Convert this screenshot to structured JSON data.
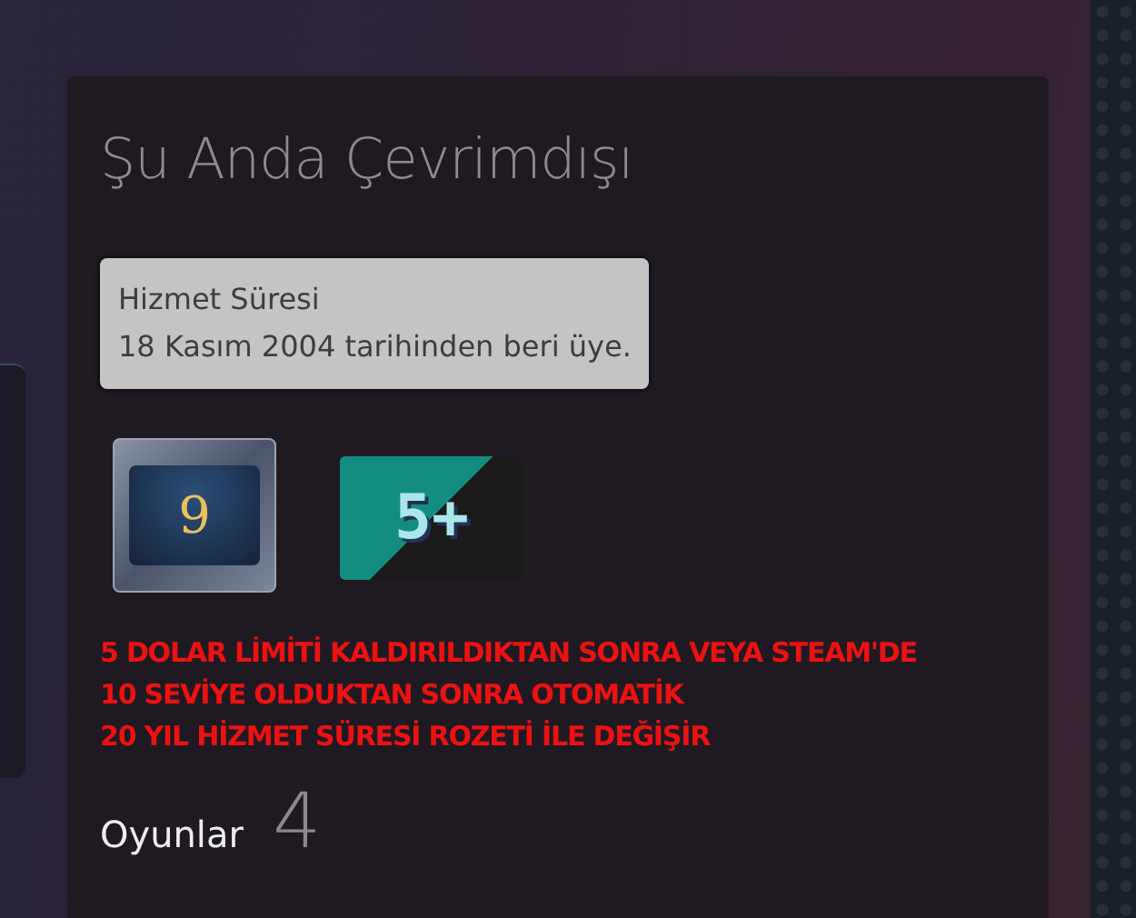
{
  "status": {
    "title": "Şu Anda Çevrimdışı"
  },
  "tooltip": {
    "heading": "Hizmet Süresi",
    "text": "18 Kasım 2004 tarihinden beri üye."
  },
  "badges": [
    {
      "kind": "years",
      "label": "9"
    },
    {
      "kind": "level",
      "label": "5+"
    }
  ],
  "note": [
    "5 DOLAR LİMİTİ KALDIRILDIKTAN SONRA VEYA STEAM'DE",
    "10 SEVİYE OLDUKTAN SONRA OTOMATİK",
    "20 YIL HİZMET SÜRESİ ROZETİ İLE DEĞİŞİR"
  ],
  "games": {
    "label": "Oyunlar",
    "count": "4"
  }
}
